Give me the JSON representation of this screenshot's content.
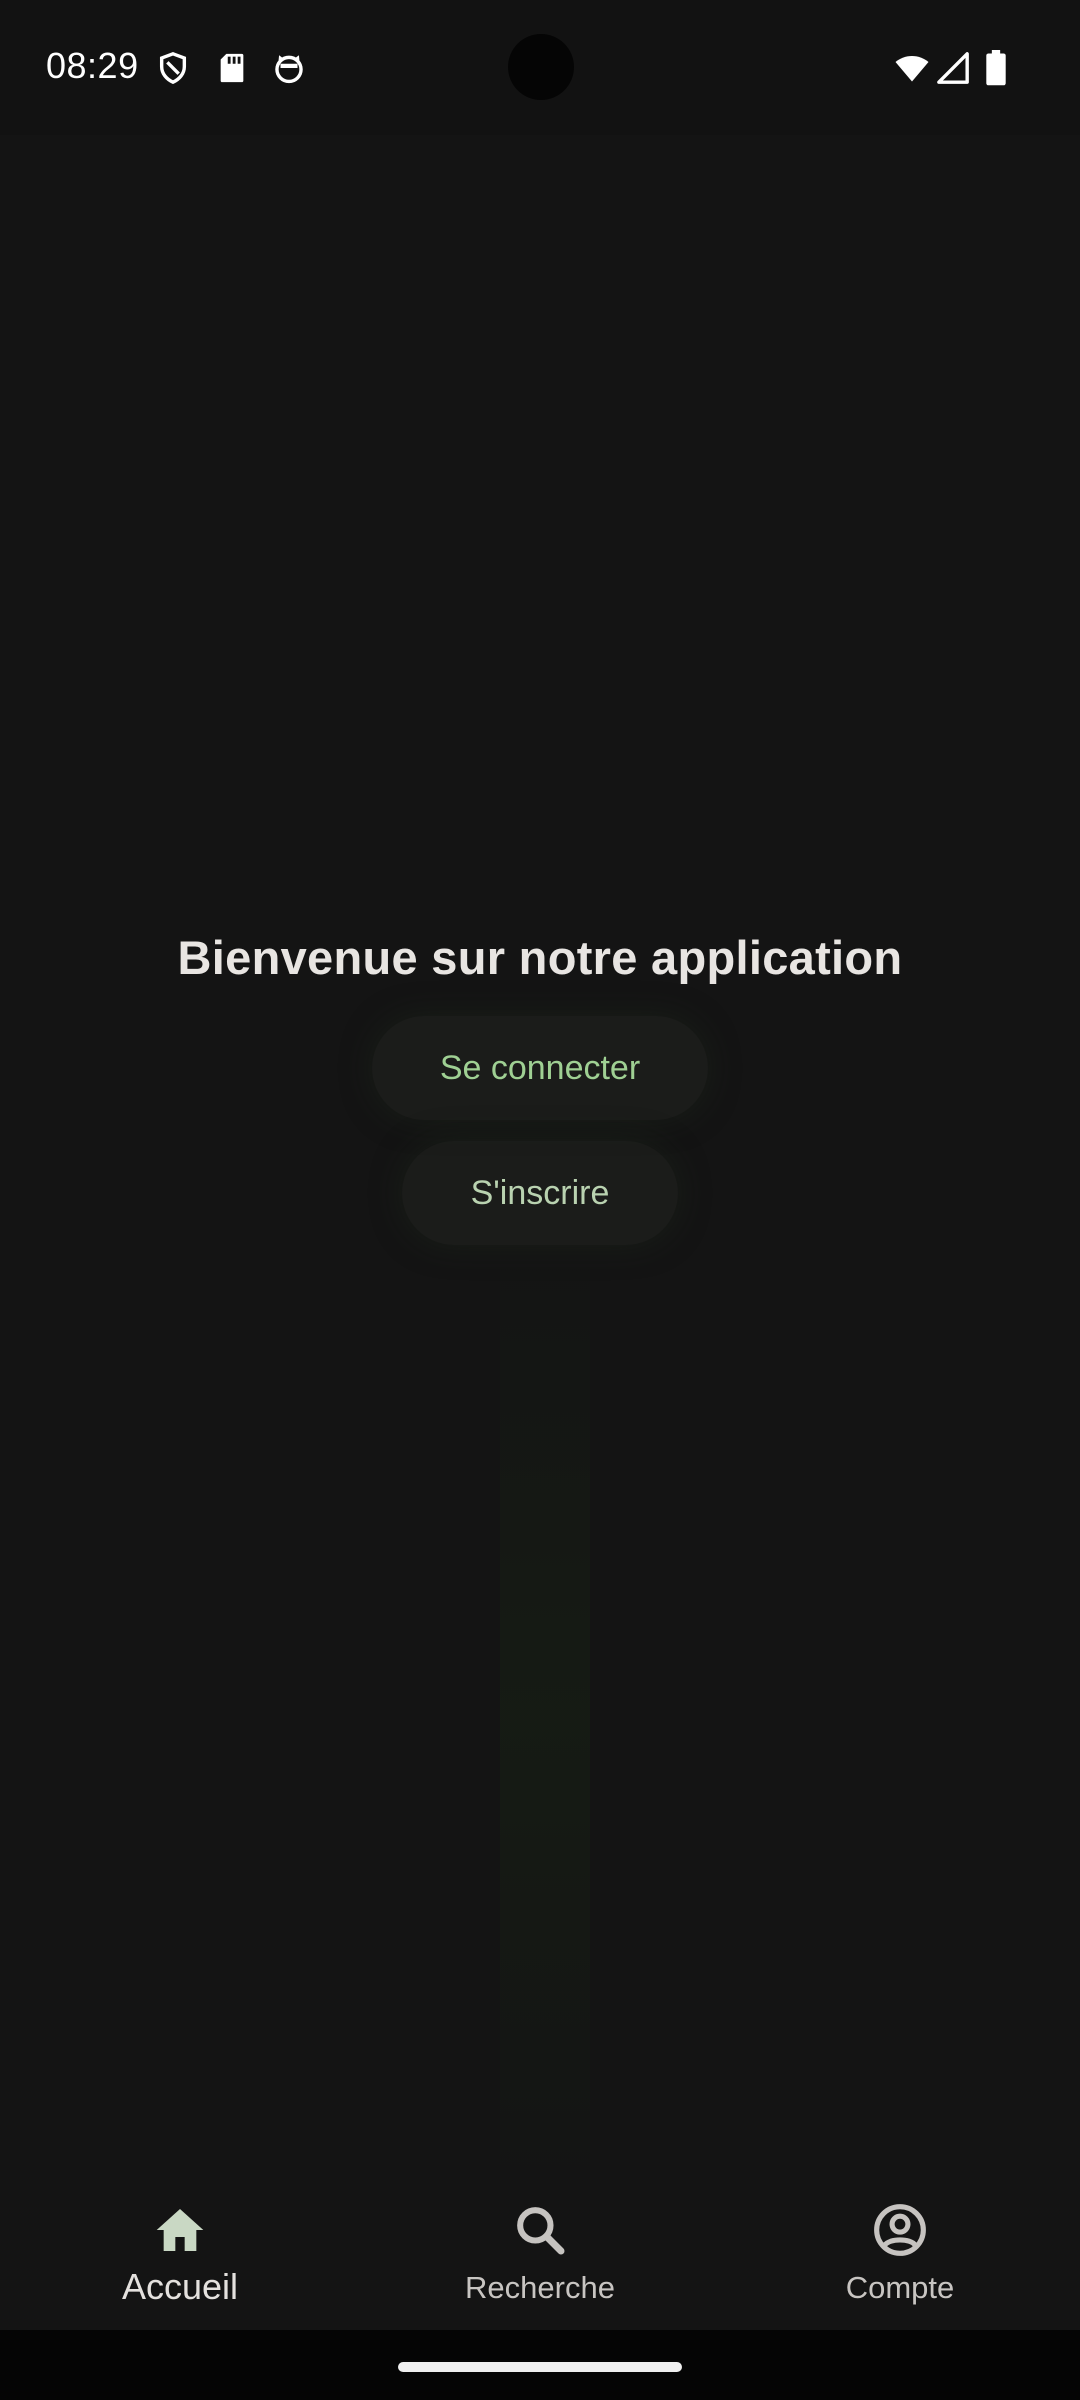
{
  "status_bar": {
    "time": "08:29",
    "left_icons": [
      "shield-icon",
      "sd-card-icon",
      "cat-face-icon"
    ],
    "right_icons": [
      "wifi-icon",
      "cellular-signal-icon",
      "battery-icon"
    ]
  },
  "main": {
    "title": "Bienvenue sur notre application",
    "login_button_label": "Se connecter",
    "signup_button_label": "S'inscrire"
  },
  "bottom_nav": {
    "items": [
      {
        "label": "Accueil",
        "icon": "home-icon",
        "active": true
      },
      {
        "label": "Recherche",
        "icon": "search-icon",
        "active": false
      },
      {
        "label": "Compte",
        "icon": "account-circle-icon",
        "active": false
      }
    ]
  },
  "colors": {
    "background": "#141414",
    "primary_text": "#e8e5e2",
    "accent_green": "#9fd093",
    "nav_icon_active": "#c9d8c4"
  }
}
